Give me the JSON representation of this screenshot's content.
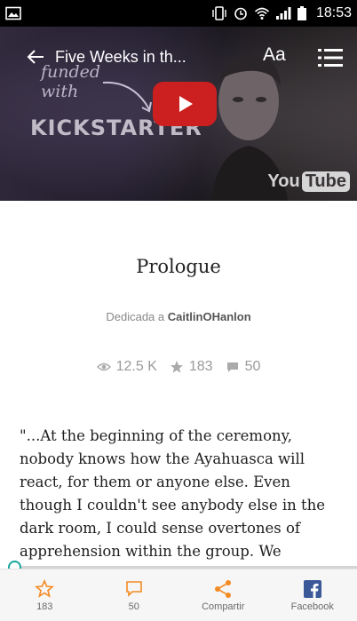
{
  "status_bar": {
    "time": "18:53"
  },
  "toolbar": {
    "title": "Five Weeks in th...",
    "font_button_label": "Aa"
  },
  "video": {
    "funded_text": "funded\nwith",
    "kickstarter_text": "KICKSTARTER",
    "youtube_text_1": "You",
    "youtube_text_2": "Tube"
  },
  "chapter": {
    "title": "Prologue",
    "dedication_prefix": "Dedicada a ",
    "dedication_name": "CaitlinOHanlon"
  },
  "stats": {
    "reads": "12.5 K",
    "votes": "183",
    "comments": "50"
  },
  "story": {
    "text": "\"...At the beginning of the ceremony, nobody knows how the Ayahuasca will react, for them or anyone else. Even though I couldn't see anybody else in the dark room, I could sense overtones of apprehension within the group. We"
  },
  "reading_progress": 0.0,
  "bottom_bar": {
    "vote_label": "183",
    "comment_label": "50",
    "share_label": "Compartir",
    "facebook_label": "Facebook"
  },
  "colors": {
    "accent": "#f38a22",
    "facebook": "#3b5998",
    "progress": "#17a6a0"
  }
}
